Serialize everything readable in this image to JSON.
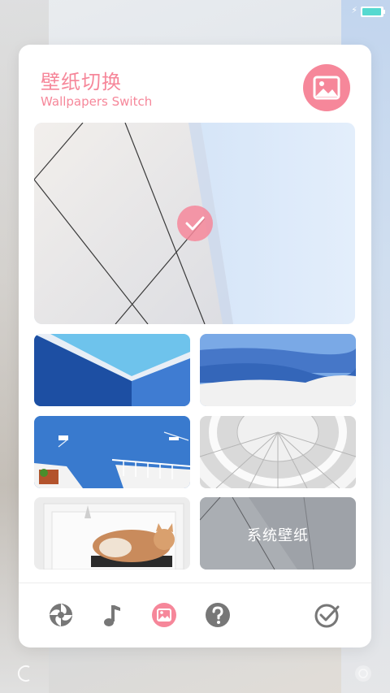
{
  "status_bar": {
    "charging_icon": "bolt-icon",
    "battery_icon": "battery-icon",
    "battery_level": 0.95,
    "battery_color": "#55d9d0"
  },
  "header": {
    "title_zh": "壁纸切换",
    "title_en": "Wallpapers Switch",
    "icon": "image-icon",
    "accent_color": "#f6879a"
  },
  "preview": {
    "selected_icon": "check-icon"
  },
  "thumbnails": [
    {
      "name": "blue-building"
    },
    {
      "name": "snow-mountains"
    },
    {
      "name": "sea-balcony"
    },
    {
      "name": "glass-dome"
    },
    {
      "name": "sleeping-cat"
    },
    {
      "label": "系统壁纸"
    }
  ],
  "nav": [
    {
      "icon": "aperture-icon"
    },
    {
      "icon": "music-note-icon"
    },
    {
      "icon": "image-icon",
      "active": true
    },
    {
      "icon": "help-icon"
    },
    {
      "icon": "check-circle-icon"
    }
  ]
}
